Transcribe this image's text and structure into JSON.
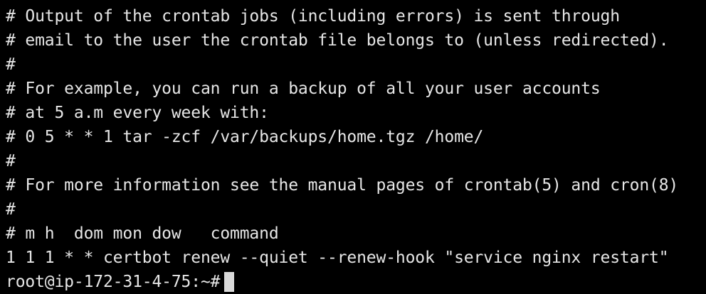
{
  "terminal": {
    "lines": [
      "# Output of the crontab jobs (including errors) is sent through",
      "# email to the user the crontab file belongs to (unless redirected).",
      "#",
      "# For example, you can run a backup of all your user accounts",
      "# at 5 a.m every week with:",
      "# 0 5 * * 1 tar -zcf /var/backups/home.tgz /home/",
      "#",
      "# For more information see the manual pages of crontab(5) and cron(8)",
      "#",
      "# m h  dom mon dow   command",
      "1 1 1 * * certbot renew --quiet --renew-hook \"service nginx restart\""
    ],
    "prompt": "root@ip-172-31-4-75:~#"
  },
  "colors": {
    "background": "#000000",
    "text": "#e6e6e6",
    "cursor": "#d9d9d9"
  }
}
